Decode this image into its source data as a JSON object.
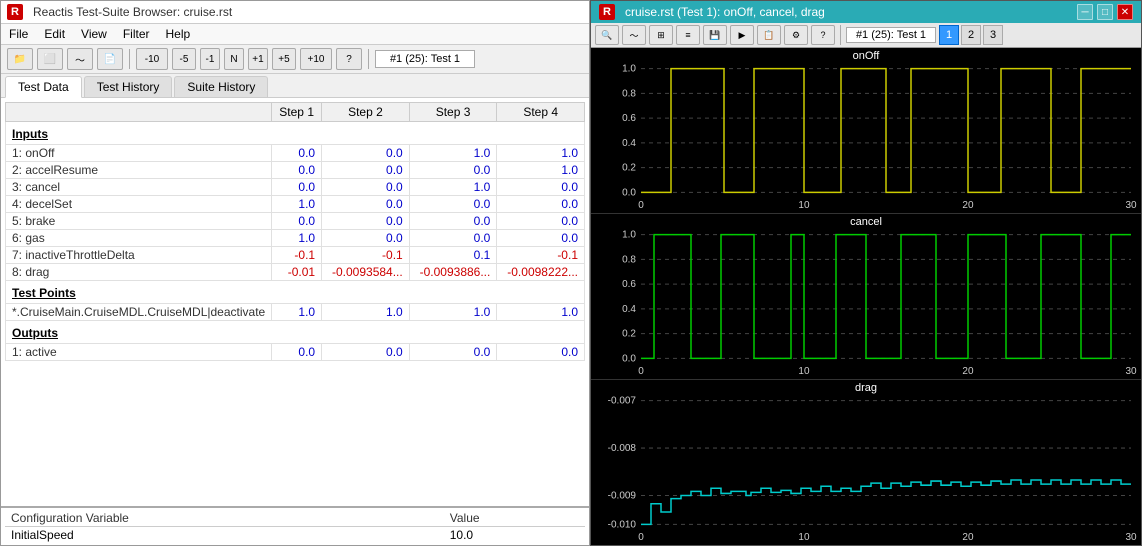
{
  "leftPanel": {
    "titleBar": {
      "appName": "Reactis Test-Suite Browser: cruise.rst"
    },
    "menu": [
      "File",
      "Edit",
      "View",
      "Filter",
      "Help"
    ],
    "toolbar": {
      "buttons": [
        "folder-open",
        "ellipsis",
        "waveform",
        "document",
        "-10",
        "-5",
        "-1",
        "N",
        "+1",
        "+5",
        "+10",
        "help"
      ],
      "testLabel": "#1 (25): Test 1"
    },
    "tabs": [
      "Test Data",
      "Test History",
      "Suite History"
    ],
    "activeTab": "Test Data",
    "columns": [
      "",
      "Step 1",
      "Step 2",
      "Step 3",
      "Step 4"
    ],
    "sections": {
      "inputs": {
        "label": "Inputs",
        "rows": [
          {
            "id": "1: onOff",
            "s1": "0.0",
            "s2": "0.0",
            "s3": "1.0",
            "s4": "1.0"
          },
          {
            "id": "2: accelResume",
            "s1": "0.0",
            "s2": "0.0",
            "s3": "0.0",
            "s4": "1.0"
          },
          {
            "id": "3: cancel",
            "s1": "0.0",
            "s2": "0.0",
            "s3": "1.0",
            "s4": "0.0"
          },
          {
            "id": "4: decelSet",
            "s1": "1.0",
            "s2": "0.0",
            "s3": "0.0",
            "s4": "0.0"
          },
          {
            "id": "5: brake",
            "s1": "0.0",
            "s2": "0.0",
            "s3": "0.0",
            "s4": "0.0"
          },
          {
            "id": "6: gas",
            "s1": "1.0",
            "s2": "0.0",
            "s3": "0.0",
            "s4": "0.0"
          },
          {
            "id": "7: inactiveThrottleDelta",
            "s1": "-0.1",
            "s2": "-0.1",
            "s3": "0.1",
            "s4": "-0.1"
          },
          {
            "id": "8: drag",
            "s1": "-0.01",
            "s2": "-0.0093584...",
            "s3": "-0.0093886...",
            "s4": "-0.0098222..."
          }
        ]
      },
      "testPoints": {
        "label": "Test Points",
        "rows": [
          {
            "id": "*.CruiseMain.CruiseMDL.CruiseMDL|deactivate",
            "s1": "1.0",
            "s2": "1.0",
            "s3": "1.0",
            "s4": "1.0"
          }
        ]
      },
      "outputs": {
        "label": "Outputs",
        "rows": [
          {
            "id": "1: active",
            "s1": "0.0",
            "s2": "0.0",
            "s3": "0.0",
            "s4": "0.0"
          }
        ]
      }
    },
    "configTable": {
      "headers": [
        "Configuration Variable",
        "Value"
      ],
      "rows": [
        {
          "var": "InitialSpeed",
          "val": "10.0"
        }
      ]
    }
  },
  "rightPanel": {
    "titleBar": {
      "title": "cruise.rst (Test 1): onOff, cancel, drag",
      "controls": [
        "minimize",
        "maximize",
        "close"
      ]
    },
    "toolbar": {
      "testLabel": "#1 (25): Test 1",
      "numButtons": [
        "1",
        "2",
        "3"
      ],
      "activeNum": "1"
    },
    "charts": [
      {
        "title": "onOff",
        "color": "#cccc00",
        "yMin": 0.0,
        "yMax": 1.0,
        "yLabels": [
          "1.0",
          "0.8",
          "0.6",
          "0.4",
          "0.2",
          "0.0"
        ],
        "xMax": 30
      },
      {
        "title": "cancel",
        "color": "#00cc00",
        "yMin": 0.0,
        "yMax": 1.0,
        "yLabels": [
          "1.0",
          "0.8",
          "0.6",
          "0.4",
          "0.2",
          "0.0"
        ],
        "xMax": 30
      },
      {
        "title": "drag",
        "color": "#00cccc",
        "yMin": -0.01,
        "yMax": -0.007,
        "yLabels": [
          "-0.007",
          "-0.008",
          "-0.009",
          "-0.010"
        ],
        "xMax": 30
      }
    ]
  }
}
